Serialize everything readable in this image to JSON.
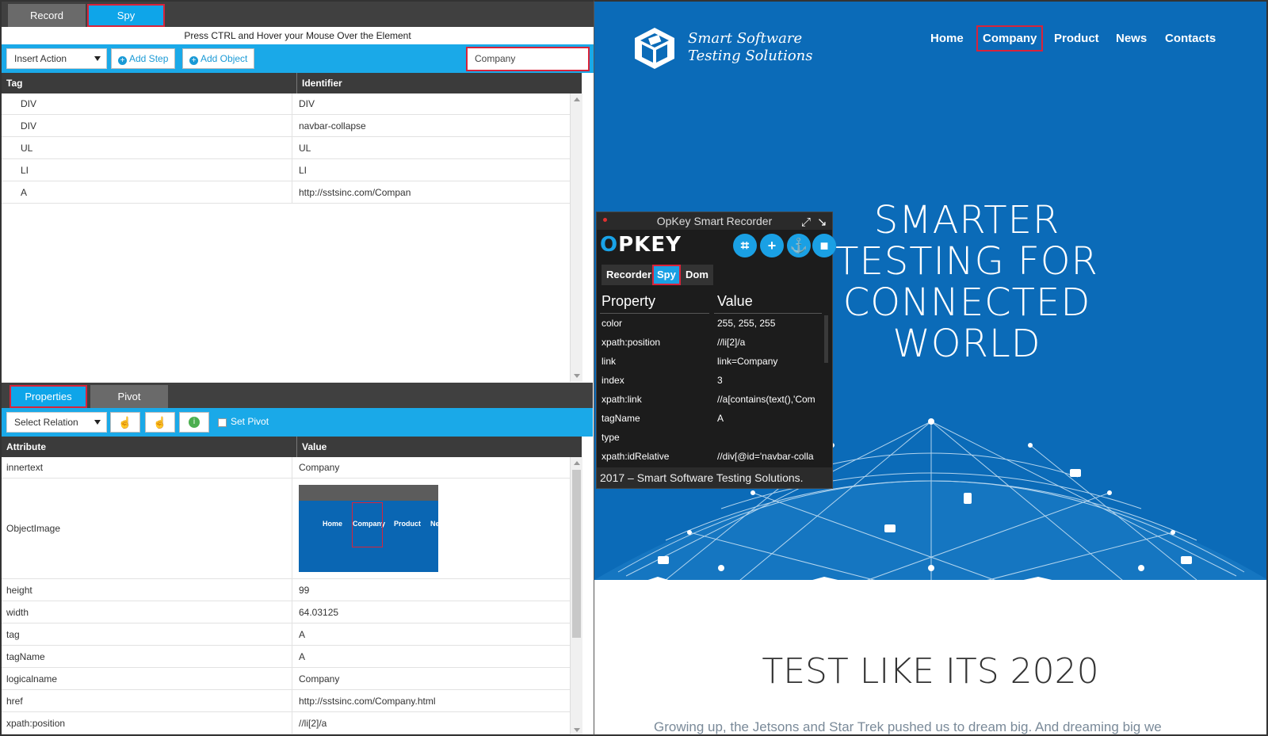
{
  "spy_tool": {
    "tabs": {
      "record": "Record",
      "spy": "Spy"
    },
    "hint": "Press CTRL and Hover your Mouse Over the Element",
    "toolbar": {
      "insert_action": "Insert Action",
      "add_step": "Add Step",
      "add_object": "Add Object",
      "search_value": "Company"
    },
    "element_grid": {
      "headers": [
        "Tag",
        "Identifier"
      ],
      "rows": [
        {
          "tag": "DIV",
          "identifier": "DIV"
        },
        {
          "tag": "DIV",
          "identifier": "navbar-collapse"
        },
        {
          "tag": "UL",
          "identifier": "UL"
        },
        {
          "tag": "LI",
          "identifier": "LI"
        },
        {
          "tag": "A",
          "identifier": "http://sstsinc.com/Compan"
        }
      ]
    },
    "bottom_tabs": {
      "properties": "Properties",
      "pivot": "Pivot"
    },
    "bottom_toolbar": {
      "select_relation": "Select Relation",
      "set_pivot": "Set Pivot"
    },
    "attribute_grid": {
      "headers": [
        "Attribute",
        "Value"
      ],
      "rows": [
        {
          "attribute": "innertext",
          "value": "Company"
        },
        {
          "attribute": "ObjectImage",
          "value": ""
        },
        {
          "attribute": "height",
          "value": "99"
        },
        {
          "attribute": "width",
          "value": "64.03125"
        },
        {
          "attribute": "tag",
          "value": "A"
        },
        {
          "attribute": "tagName",
          "value": "A"
        },
        {
          "attribute": "logicalname",
          "value": "Company"
        },
        {
          "attribute": "href",
          "value": "http://sstsinc.com/Company.html"
        },
        {
          "attribute": "xpath:position",
          "value": "//li[2]/a"
        }
      ],
      "object_image_labels": [
        "Home",
        "Company",
        "Product",
        "Ne"
      ]
    }
  },
  "website": {
    "logo_line1": "Smart Software",
    "logo_line2": "Testing Solutions",
    "nav": [
      "Home",
      "Company",
      "Product",
      "News",
      "Contacts"
    ],
    "hero_lines": [
      "SMARTER",
      "TESTING FOR",
      "CONNECTED",
      "WORLD"
    ],
    "section_title": "TEST LIKE ITS 2020",
    "section_text": "Growing up, the Jetsons and Star Trek pushed us to dream big. And dreaming big we"
  },
  "opkey_recorder": {
    "title": "OpKey Smart Recorder",
    "logo": "PKEY",
    "tabs": [
      "Recorder",
      "Spy",
      "Dom"
    ],
    "headers": [
      "Property",
      "Value"
    ],
    "rows": [
      {
        "property": "color",
        "value": "255, 255, 255"
      },
      {
        "property": "xpath:position",
        "value": "//li[2]/a"
      },
      {
        "property": "link",
        "value": "link=Company"
      },
      {
        "property": "index",
        "value": "3"
      },
      {
        "property": "xpath:link",
        "value": "//a[contains(text(),'Com"
      },
      {
        "property": "tagName",
        "value": "A"
      },
      {
        "property": "type",
        "value": ""
      },
      {
        "property": "xpath:idRelative",
        "value": "//div[@id='navbar-colla"
      }
    ],
    "footer": "2017 – Smart Software Testing Solutions."
  },
  "colors": {
    "accent": "#1aa9e8",
    "highlight": "#d9233a",
    "site_blue": "#0b6bb8",
    "dark_header": "#3b3b3b"
  }
}
